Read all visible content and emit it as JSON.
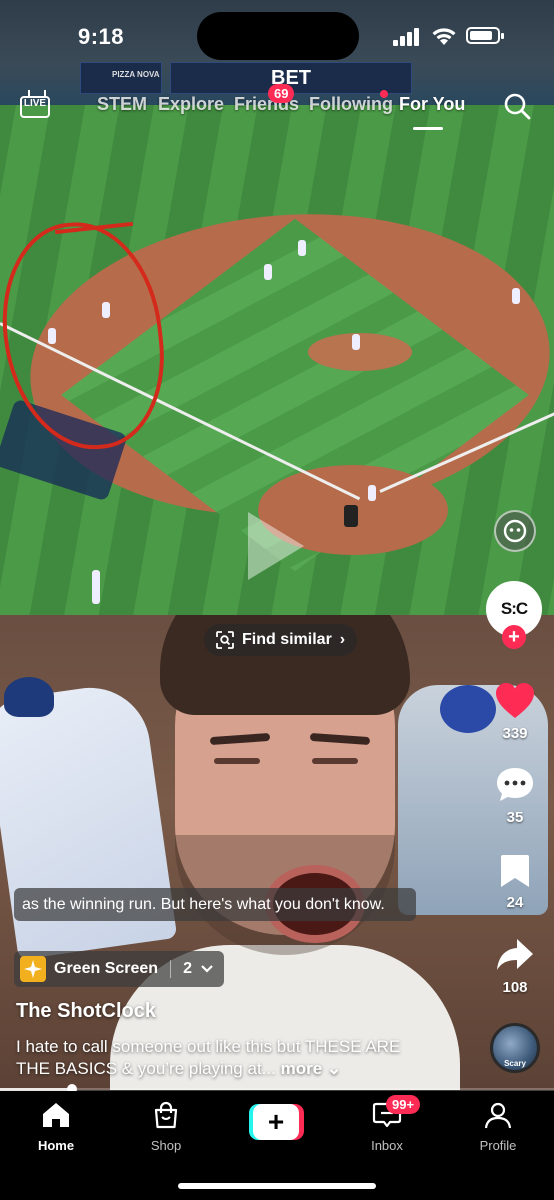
{
  "status_bar": {
    "time": "9:18",
    "battery_level": 0.85
  },
  "top_nav": {
    "live_label": "LIVE",
    "tabs": [
      {
        "label": "STEM"
      },
      {
        "label": "Explore"
      },
      {
        "label": "Friends",
        "badge": "69"
      },
      {
        "label": "Following"
      },
      {
        "label": "For You",
        "active": true
      }
    ]
  },
  "overlay": {
    "find_similar_label": "Find similar",
    "caption": "as the winning run. But here's what you don't know.",
    "effect": {
      "name": "Green Screen",
      "count": "2"
    },
    "author": "The ShotClock",
    "description": "I hate to call someone out like this but THESE ARE THE BASICS & you’re playing at...",
    "more_label": "more",
    "progress": 0.13
  },
  "creator": {
    "avatar_text": "S:C"
  },
  "actions": {
    "likes": "339",
    "comments": "35",
    "saves": "24",
    "shares": "108"
  },
  "sound": {
    "label": "Scary"
  },
  "video_text": {
    "sponsor_banner": "BET",
    "pizza_banner": "PIZZA NOVA"
  },
  "bottom_nav": {
    "items": [
      {
        "label": "Home",
        "active": true
      },
      {
        "label": "Shop"
      },
      {
        "label": ""
      },
      {
        "label": "Inbox",
        "badge": "99+"
      },
      {
        "label": "Profile"
      }
    ]
  },
  "colors": {
    "accent": "#fe2c55",
    "teal": "#25f4ee",
    "like": "#fe2c55"
  }
}
